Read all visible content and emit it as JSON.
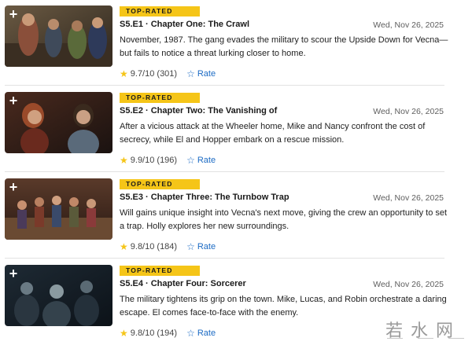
{
  "episodes": [
    {
      "badge": "TOP-RATED",
      "title": "S5.E1 · Chapter One: The Crawl",
      "date": "Wed, Nov 26, 2025",
      "description": "November, 1987. The gang evades the military to scour the Upside Down for Vecna—but fails to notice a threat lurking closer to home.",
      "rating": "9.7/10 (301)",
      "rate_label": "Rate"
    },
    {
      "badge": "TOP-RATED",
      "title": "S5.E2 · Chapter Two: The Vanishing of",
      "date": "Wed, Nov 26, 2025",
      "description": "After a vicious attack at the Wheeler home, Mike and Nancy confront the cost of secrecy, while El and Hopper embark on a rescue mission.",
      "rating": "9.9/10 (196)",
      "rate_label": "Rate"
    },
    {
      "badge": "TOP-RATED",
      "title": "S5.E3 · Chapter Three: The Turnbow Trap",
      "date": "Wed, Nov 26, 2025",
      "description": "Will gains unique insight into Vecna's next move, giving the crew an opportunity to set a trap. Holly explores her new surroundings.",
      "rating": "9.8/10 (184)",
      "rate_label": "Rate"
    },
    {
      "badge": "TOP-RATED",
      "title": "S5.E4 · Chapter Four: Sorcerer",
      "date": "Wed, Nov 26, 2025",
      "description": "The military tightens its grip on the town. Mike, Lucas, and Robin orchestrate a daring escape. El comes face-to-face with the enemy.",
      "rating": "9.8/10 (194)",
      "rate_label": "Rate"
    }
  ],
  "add_glyph": "+",
  "watermark": "若水网",
  "colors": {
    "badge": "#f5c518",
    "star": "#f5c518",
    "link": "#1c6bc4",
    "divider": "#e2e2e2"
  },
  "icons": {
    "rating": "star-icon",
    "rate": "star-outline-icon",
    "add": "plus-icon"
  }
}
